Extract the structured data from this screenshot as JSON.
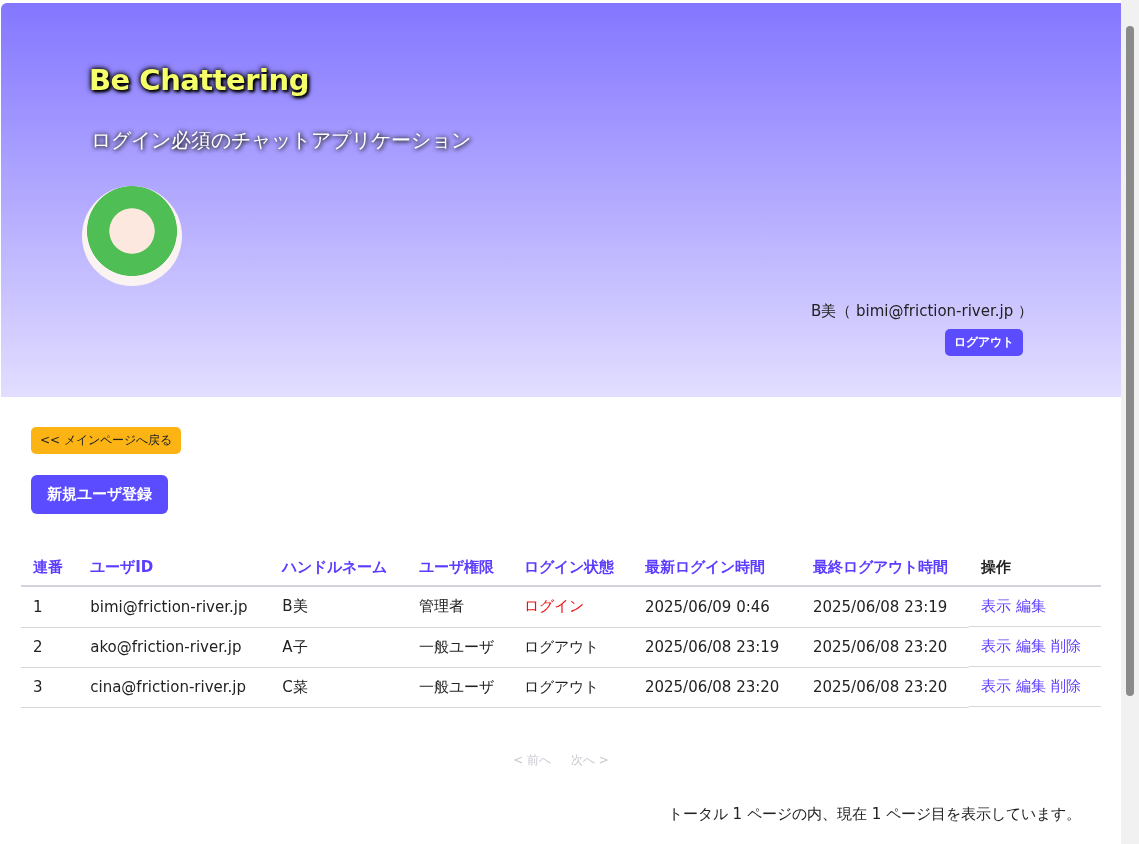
{
  "header": {
    "title": "Be Chattering",
    "subtitle": "ログイン必須のチャットアプリケーション",
    "user": "B美（ bimi@friction-river.jp ）",
    "logout_button": "ログアウト"
  },
  "back_button": "<< メインページへ戻る",
  "new_user_button": "新規ユーザ登録",
  "table": {
    "columns": [
      {
        "label": "連番",
        "sortable": true
      },
      {
        "label": "ユーザID",
        "sortable": true
      },
      {
        "label": "ハンドルネーム",
        "sortable": true
      },
      {
        "label": "ユーザ権限",
        "sortable": true
      },
      {
        "label": "ログイン状態",
        "sortable": true
      },
      {
        "label": "最新ログイン時間",
        "sortable": true
      },
      {
        "label": "最終ログアウト時間",
        "sortable": true
      },
      {
        "label": "操作",
        "sortable": false
      }
    ],
    "rows": [
      {
        "no": "1",
        "user_id": "bimi@friction-river.jp",
        "handle": "B美",
        "role": "管理者",
        "login_state": "ログイン",
        "logged_in": true,
        "last_login": "2025/06/09 0:46",
        "last_logout": "2025/06/08 23:19",
        "actions": [
          "表示",
          "編集"
        ]
      },
      {
        "no": "2",
        "user_id": "ako@friction-river.jp",
        "handle": "A子",
        "role": "一般ユーザ",
        "login_state": "ログアウト",
        "logged_in": false,
        "last_login": "2025/06/08 23:19",
        "last_logout": "2025/06/08 23:20",
        "actions": [
          "表示",
          "編集",
          "削除"
        ]
      },
      {
        "no": "3",
        "user_id": "cina@friction-river.jp",
        "handle": "C菜",
        "role": "一般ユーザ",
        "login_state": "ログアウト",
        "logged_in": false,
        "last_login": "2025/06/08 23:20",
        "last_logout": "2025/06/08 23:20",
        "actions": [
          "表示",
          "編集",
          "削除"
        ]
      }
    ]
  },
  "pagination": [
    {
      "label": "< 前へ",
      "disabled": true
    },
    {
      "label": "次へ >",
      "disabled": true
    }
  ],
  "page_info": "トータル 1 ページの内、現在 1 ページ目を表示しています。"
}
